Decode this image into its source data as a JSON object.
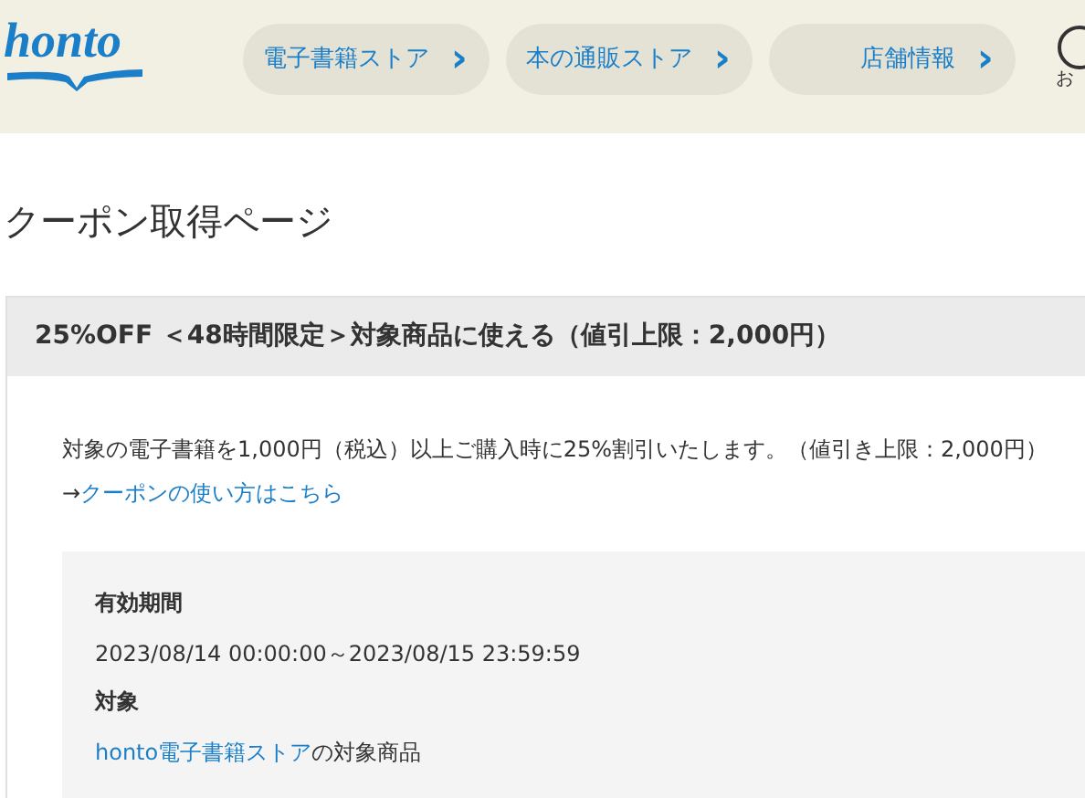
{
  "header": {
    "logo": "honto",
    "nav": [
      {
        "label": "電子書籍ストア",
        "arrow": "›"
      },
      {
        "label": "本の通販ストア",
        "arrow": "›"
      },
      {
        "label": "店舗情報",
        "arrow": "›"
      }
    ],
    "notice_label": "お"
  },
  "page_title": "クーポン取得ページ",
  "coupon": {
    "title": "25%OFF ＜48時間限定＞対象商品に使える（値引上限：2,000円）",
    "description": "対象の電子書籍を1,000円（税込）以上ご購入時に25%割引いたします。（値引き上限：2,000円）",
    "usage_link_prefix": "→",
    "usage_link": "クーポンの使い方はこちら",
    "details": [
      {
        "label": "有効期間",
        "value": "2023/08/14 00:00:00～2023/08/15 23:59:59"
      },
      {
        "label": "対象",
        "link": "honto電子書籍ストア",
        "value": "の対象商品"
      }
    ]
  }
}
